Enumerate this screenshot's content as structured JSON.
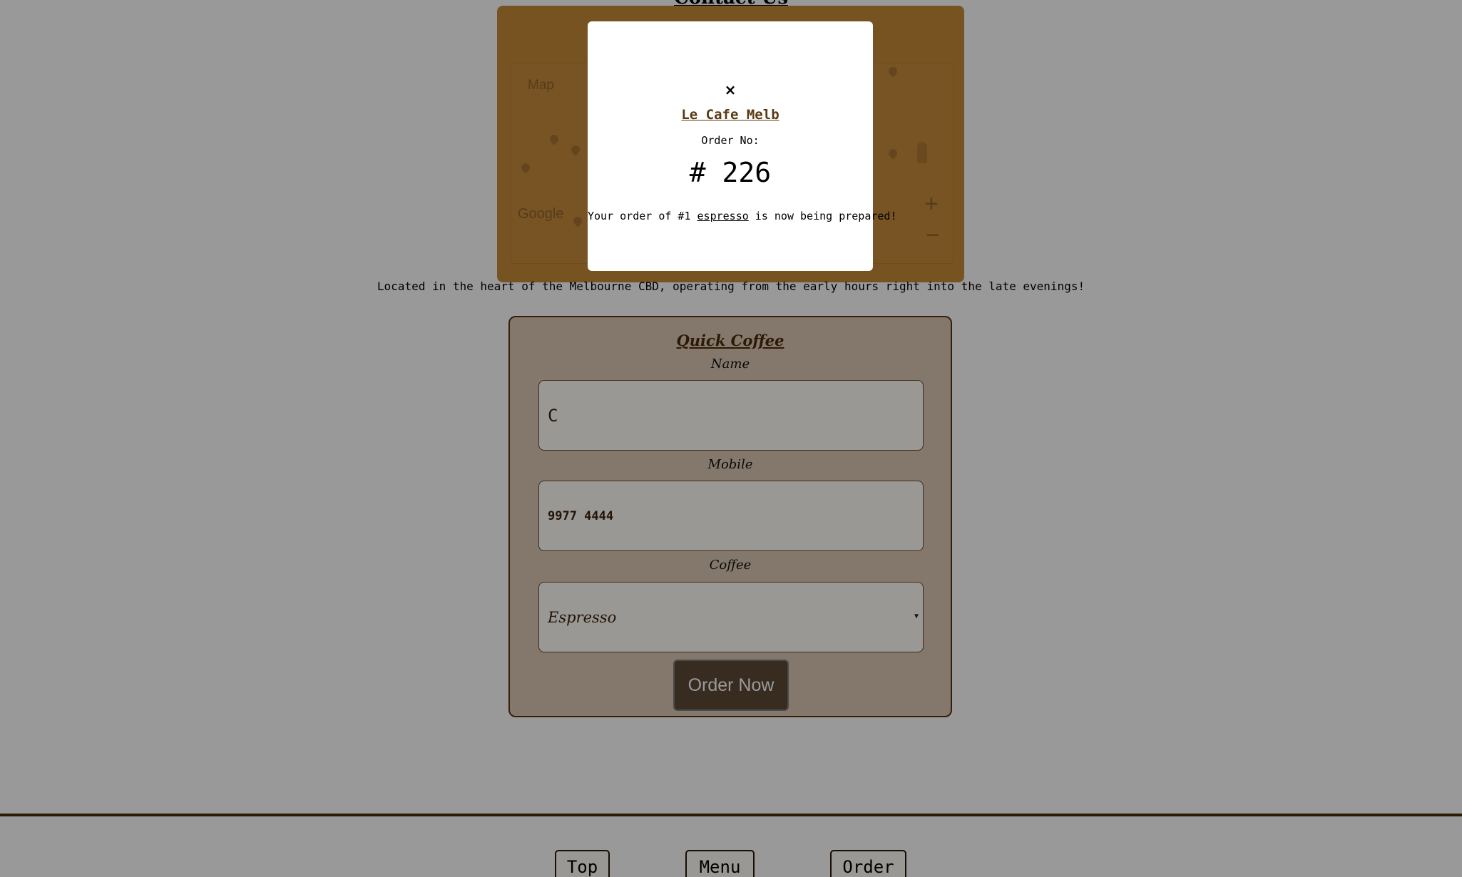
{
  "contact": {
    "heading": "Contact Us",
    "map": {
      "tab_label": "Map",
      "attribution": "Google",
      "zoom_in": "+",
      "zoom_out": "−"
    },
    "located_text": "Located in the heart of the Melbourne CBD, operating from the early hours right into the late evenings!"
  },
  "quick_coffee": {
    "title": "Quick Coffee",
    "name_label": "Name",
    "name_value": "C",
    "mobile_label": "Mobile",
    "mobile_value": "9977 4444",
    "coffee_label": "Coffee",
    "coffee_selected": "Espresso",
    "order_button": "Order Now"
  },
  "footer": {
    "nav": [
      "Top",
      "Menu",
      "Order"
    ]
  },
  "modal": {
    "close_icon": "×",
    "title": "Le Cafe Melb",
    "order_no_label": "Order No:",
    "order_no": "# 226",
    "message_prefix": "Your order of #1 ",
    "message_item": "espresso",
    "message_suffix": " is now being prepared!"
  },
  "colors": {
    "brand_brown": "#5a3410",
    "map_tint": "#c68a39",
    "overlay": "rgba(0,0,0,0.4)",
    "button_bg": "#5e4a38"
  }
}
